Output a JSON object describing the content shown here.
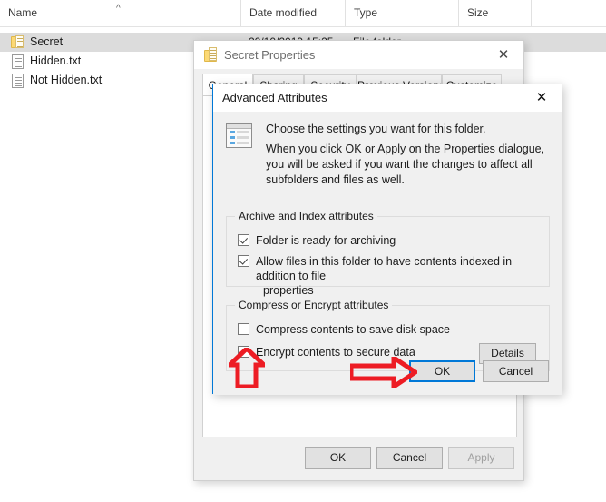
{
  "explorer": {
    "columns": [
      {
        "key": "name",
        "label": "Name",
        "sorted": true,
        "sort_glyph": "^"
      },
      {
        "key": "date",
        "label": "Date modified"
      },
      {
        "key": "type",
        "label": "Type"
      },
      {
        "key": "size",
        "label": "Size"
      }
    ],
    "rows": [
      {
        "name": "Secret",
        "icon": "folder-encrypted-icon",
        "selected": true,
        "date": "20/10/2019 15:25",
        "type": "File folder",
        "size": ""
      },
      {
        "name": "Hidden.txt",
        "icon": "text-file-icon",
        "selected": false,
        "date": "",
        "type": "",
        "size": ""
      },
      {
        "name": "Not Hidden.txt",
        "icon": "text-file-icon",
        "selected": false,
        "date": "",
        "type": "",
        "size": ""
      }
    ]
  },
  "properties_window": {
    "title": "Secret Properties",
    "title_icon": "folder-encrypted-icon",
    "close_glyph": "✕",
    "tabs": [
      {
        "label": "General",
        "active": true
      },
      {
        "label": "Sharing",
        "active": false
      },
      {
        "label": "Security",
        "active": false
      },
      {
        "label": "Previous Versions",
        "active": false
      },
      {
        "label": "Customize",
        "active": false
      }
    ],
    "buttons": {
      "ok": "OK",
      "cancel": "Cancel",
      "apply": "Apply",
      "apply_disabled": true
    }
  },
  "advanced_dialog": {
    "title": "Advanced Attributes",
    "close_glyph": "✕",
    "icon": "settings-checklist-icon",
    "intro_line1": "Choose the settings you want for this folder.",
    "intro_line2": "When you click OK or Apply on the Properties dialogue, you will be asked if you want the changes to affect all subfolders and files as well.",
    "groups": [
      {
        "legend": "Archive and Index attributes",
        "checkboxes": [
          {
            "label": "Folder is ready for archiving",
            "checked": true
          },
          {
            "label": "Allow files in this folder to have contents indexed in addition to file",
            "label_line2": "properties",
            "checked": true
          }
        ]
      },
      {
        "legend": "Compress or Encrypt attributes",
        "checkboxes": [
          {
            "label": "Compress contents to save disk space",
            "checked": false
          },
          {
            "label": "Encrypt contents to secure data",
            "checked": true
          }
        ],
        "details_button": "Details"
      }
    ],
    "buttons": {
      "ok": "OK",
      "cancel": "Cancel"
    }
  },
  "annotations": {
    "color": "#ED1C24",
    "arrow_up": "arrow-up-annotation",
    "arrow_right": "arrow-right-annotation"
  },
  "theme": {
    "accent": "#0078D7",
    "window_bg": "#F0F0F0",
    "selection_bg": "#DCDCDC",
    "folder_yellow": "#FCD975"
  }
}
